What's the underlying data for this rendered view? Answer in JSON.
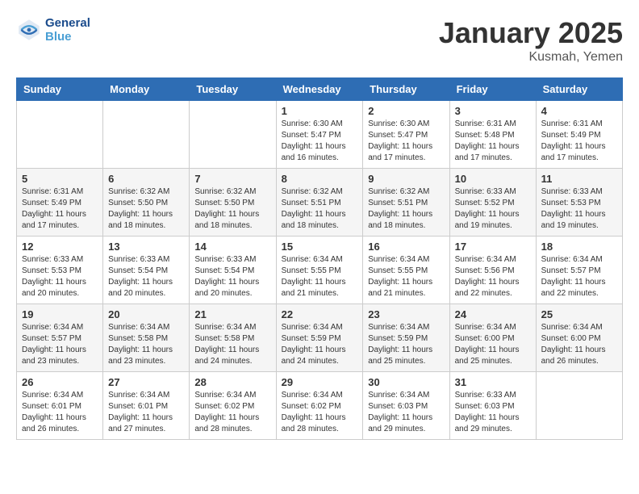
{
  "header": {
    "logo_line1": "General",
    "logo_line2": "Blue",
    "month_title": "January 2025",
    "location": "Kusmah, Yemen"
  },
  "days_of_week": [
    "Sunday",
    "Monday",
    "Tuesday",
    "Wednesday",
    "Thursday",
    "Friday",
    "Saturday"
  ],
  "weeks": [
    [
      {
        "day": "",
        "detail": ""
      },
      {
        "day": "",
        "detail": ""
      },
      {
        "day": "",
        "detail": ""
      },
      {
        "day": "1",
        "detail": "Sunrise: 6:30 AM\nSunset: 5:47 PM\nDaylight: 11 hours\nand 16 minutes."
      },
      {
        "day": "2",
        "detail": "Sunrise: 6:30 AM\nSunset: 5:47 PM\nDaylight: 11 hours\nand 17 minutes."
      },
      {
        "day": "3",
        "detail": "Sunrise: 6:31 AM\nSunset: 5:48 PM\nDaylight: 11 hours\nand 17 minutes."
      },
      {
        "day": "4",
        "detail": "Sunrise: 6:31 AM\nSunset: 5:49 PM\nDaylight: 11 hours\nand 17 minutes."
      }
    ],
    [
      {
        "day": "5",
        "detail": "Sunrise: 6:31 AM\nSunset: 5:49 PM\nDaylight: 11 hours\nand 17 minutes."
      },
      {
        "day": "6",
        "detail": "Sunrise: 6:32 AM\nSunset: 5:50 PM\nDaylight: 11 hours\nand 18 minutes."
      },
      {
        "day": "7",
        "detail": "Sunrise: 6:32 AM\nSunset: 5:50 PM\nDaylight: 11 hours\nand 18 minutes."
      },
      {
        "day": "8",
        "detail": "Sunrise: 6:32 AM\nSunset: 5:51 PM\nDaylight: 11 hours\nand 18 minutes."
      },
      {
        "day": "9",
        "detail": "Sunrise: 6:32 AM\nSunset: 5:51 PM\nDaylight: 11 hours\nand 18 minutes."
      },
      {
        "day": "10",
        "detail": "Sunrise: 6:33 AM\nSunset: 5:52 PM\nDaylight: 11 hours\nand 19 minutes."
      },
      {
        "day": "11",
        "detail": "Sunrise: 6:33 AM\nSunset: 5:53 PM\nDaylight: 11 hours\nand 19 minutes."
      }
    ],
    [
      {
        "day": "12",
        "detail": "Sunrise: 6:33 AM\nSunset: 5:53 PM\nDaylight: 11 hours\nand 20 minutes."
      },
      {
        "day": "13",
        "detail": "Sunrise: 6:33 AM\nSunset: 5:54 PM\nDaylight: 11 hours\nand 20 minutes."
      },
      {
        "day": "14",
        "detail": "Sunrise: 6:33 AM\nSunset: 5:54 PM\nDaylight: 11 hours\nand 20 minutes."
      },
      {
        "day": "15",
        "detail": "Sunrise: 6:34 AM\nSunset: 5:55 PM\nDaylight: 11 hours\nand 21 minutes."
      },
      {
        "day": "16",
        "detail": "Sunrise: 6:34 AM\nSunset: 5:55 PM\nDaylight: 11 hours\nand 21 minutes."
      },
      {
        "day": "17",
        "detail": "Sunrise: 6:34 AM\nSunset: 5:56 PM\nDaylight: 11 hours\nand 22 minutes."
      },
      {
        "day": "18",
        "detail": "Sunrise: 6:34 AM\nSunset: 5:57 PM\nDaylight: 11 hours\nand 22 minutes."
      }
    ],
    [
      {
        "day": "19",
        "detail": "Sunrise: 6:34 AM\nSunset: 5:57 PM\nDaylight: 11 hours\nand 23 minutes."
      },
      {
        "day": "20",
        "detail": "Sunrise: 6:34 AM\nSunset: 5:58 PM\nDaylight: 11 hours\nand 23 minutes."
      },
      {
        "day": "21",
        "detail": "Sunrise: 6:34 AM\nSunset: 5:58 PM\nDaylight: 11 hours\nand 24 minutes."
      },
      {
        "day": "22",
        "detail": "Sunrise: 6:34 AM\nSunset: 5:59 PM\nDaylight: 11 hours\nand 24 minutes."
      },
      {
        "day": "23",
        "detail": "Sunrise: 6:34 AM\nSunset: 5:59 PM\nDaylight: 11 hours\nand 25 minutes."
      },
      {
        "day": "24",
        "detail": "Sunrise: 6:34 AM\nSunset: 6:00 PM\nDaylight: 11 hours\nand 25 minutes."
      },
      {
        "day": "25",
        "detail": "Sunrise: 6:34 AM\nSunset: 6:00 PM\nDaylight: 11 hours\nand 26 minutes."
      }
    ],
    [
      {
        "day": "26",
        "detail": "Sunrise: 6:34 AM\nSunset: 6:01 PM\nDaylight: 11 hours\nand 26 minutes."
      },
      {
        "day": "27",
        "detail": "Sunrise: 6:34 AM\nSunset: 6:01 PM\nDaylight: 11 hours\nand 27 minutes."
      },
      {
        "day": "28",
        "detail": "Sunrise: 6:34 AM\nSunset: 6:02 PM\nDaylight: 11 hours\nand 28 minutes."
      },
      {
        "day": "29",
        "detail": "Sunrise: 6:34 AM\nSunset: 6:02 PM\nDaylight: 11 hours\nand 28 minutes."
      },
      {
        "day": "30",
        "detail": "Sunrise: 6:34 AM\nSunset: 6:03 PM\nDaylight: 11 hours\nand 29 minutes."
      },
      {
        "day": "31",
        "detail": "Sunrise: 6:33 AM\nSunset: 6:03 PM\nDaylight: 11 hours\nand 29 minutes."
      },
      {
        "day": "",
        "detail": ""
      }
    ]
  ]
}
